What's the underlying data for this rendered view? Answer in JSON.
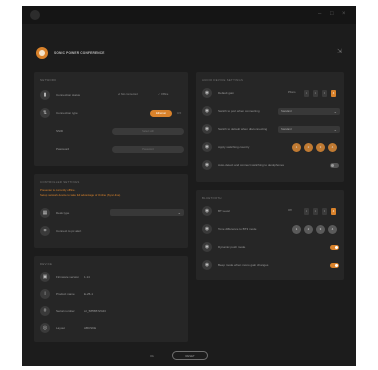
{
  "window": {
    "minimize": "–",
    "maximize": "□",
    "close": "×"
  },
  "header": {
    "title": "SONIC POWER CONFERENCE",
    "collapse": "⇲"
  },
  "network": {
    "title": "NETWORK",
    "connection_label": "Connection status",
    "status_connected": "Not connected",
    "status_offline": "Offline",
    "type_label": "Connection type",
    "type_options": [
      "Ethernet",
      "Wifi"
    ],
    "ssid_label": "SSID",
    "ssid_placeholder": "Select wifi",
    "password_label": "Password",
    "password_placeholder": "Password"
  },
  "controller": {
    "title": "CONTROLLER SETTINGS",
    "warning_line1": "Presenter is currently offline.",
    "warning_line2": "Setup network device to take full advantage of Online (Sync-line).",
    "input_label": "Desk type",
    "input_value": "",
    "reset_label": "Connect to pc alert"
  },
  "device": {
    "title": "DEVICE",
    "rows": [
      {
        "label": "Firmware version",
        "value": "1.14"
      },
      {
        "label": "Product name",
        "value": "E-25-1"
      },
      {
        "label": "Serial number",
        "value": "sz_5855B7Z443"
      },
      {
        "label": "Layout",
        "value": "ABCSKE"
      }
    ]
  },
  "audio": {
    "title": "AUDIO DEVICE SETTINGS",
    "rows": [
      {
        "label": "Default gain",
        "kind": "sq",
        "lead": "Phono",
        "options": [
          "1",
          "2",
          "3",
          "4"
        ],
        "active": 3
      },
      {
        "label": "Switch to port when connecting",
        "kind": "dd",
        "value": "Standard"
      },
      {
        "label": "Switch to default when disconnecting",
        "kind": "dd",
        "value": "Standard"
      },
      {
        "label": "Apply switching country",
        "kind": "dots",
        "options": [
          "1",
          "2",
          "3",
          "4"
        ],
        "active": -1
      },
      {
        "label": "Auto-detect and connect switching to deskphones",
        "kind": "toggle",
        "on": false
      }
    ]
  },
  "bluetooth": {
    "title": "BLUETOOTH",
    "rows": [
      {
        "label": "BT Level",
        "kind": "sq",
        "lead": "Off",
        "options": [
          "1",
          "2",
          "3",
          "4"
        ],
        "active": 3
      },
      {
        "label": "Tone difference to BT3 mode",
        "kind": "dots",
        "options": [
          "1",
          "2",
          "3",
          "4"
        ],
        "active": -1
      },
      {
        "label": "Dynamic push mode",
        "kind": "toggle",
        "on": true
      },
      {
        "label": "Beep mode when mono gain changes",
        "kind": "toggle",
        "on": true
      }
    ]
  },
  "footer": {
    "link": "Ok",
    "button": "RESET"
  }
}
